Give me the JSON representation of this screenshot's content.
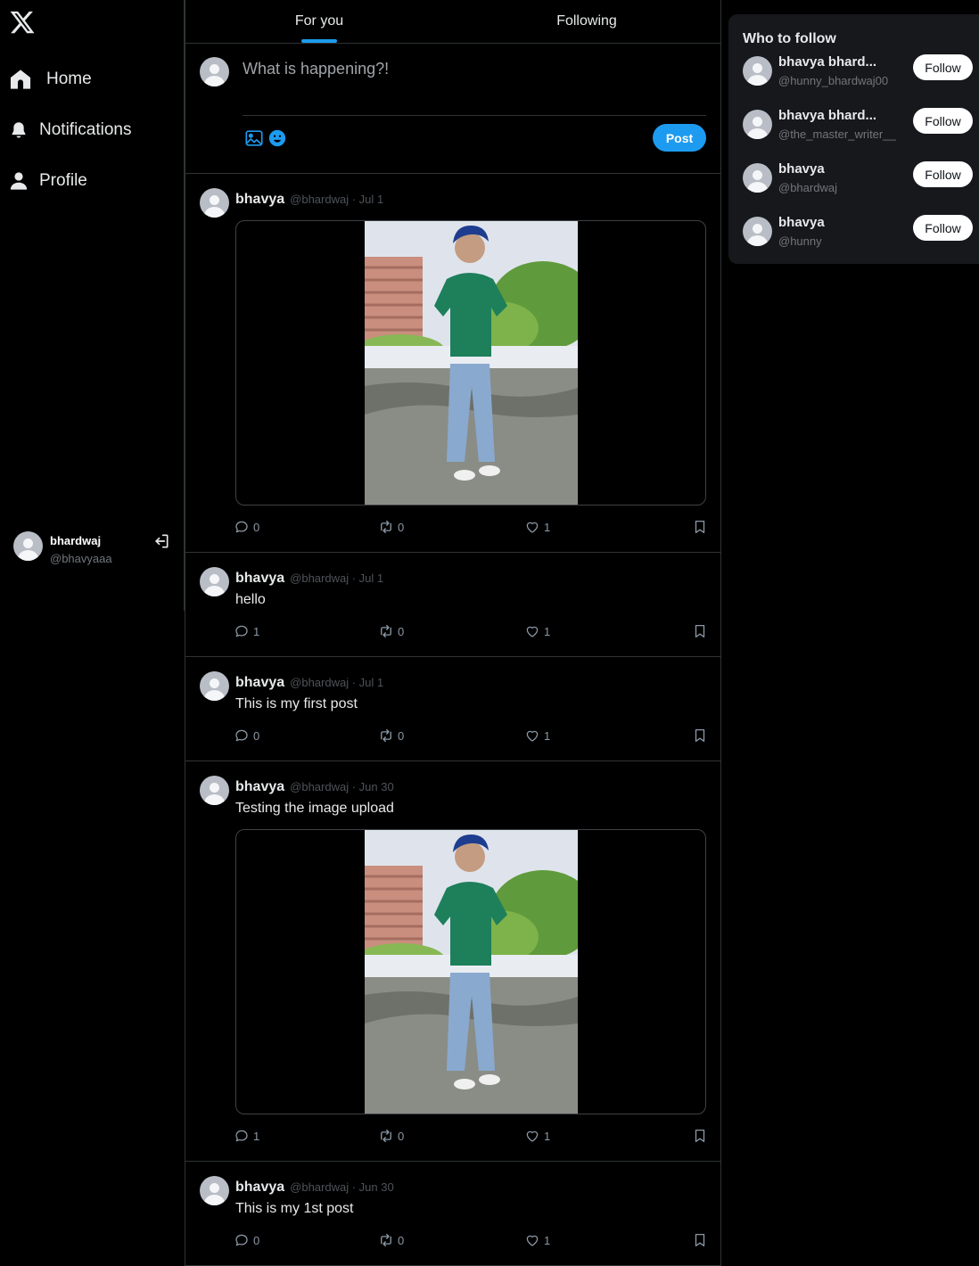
{
  "nav": {
    "logo": "x-logo",
    "items": [
      {
        "label": "Home",
        "icon": "home-icon"
      },
      {
        "label": "Notifications",
        "icon": "bell-icon"
      },
      {
        "label": "Profile",
        "icon": "person-icon"
      }
    ]
  },
  "current_user": {
    "name": "bhardwaj",
    "handle": "@bhavyaaa"
  },
  "tabs": [
    {
      "label": "For you",
      "active": true
    },
    {
      "label": "Following",
      "active": false
    }
  ],
  "composer": {
    "placeholder": "What is happening?!",
    "post_label": "Post"
  },
  "posts": [
    {
      "name": "bhavya",
      "meta": "@bhardwaj · Jul 1",
      "text": "",
      "has_image": true,
      "replies": "0",
      "retweets": "0",
      "likes": "1"
    },
    {
      "name": "bhavya",
      "meta": "@bhardwaj · Jul 1",
      "text": "hello",
      "has_image": false,
      "replies": "1",
      "retweets": "0",
      "likes": "1"
    },
    {
      "name": "bhavya",
      "meta": "@bhardwaj · Jul 1",
      "text": "This is my first post",
      "has_image": false,
      "replies": "0",
      "retweets": "0",
      "likes": "1"
    },
    {
      "name": "bhavya",
      "meta": "@bhardwaj · Jun 30",
      "text": "Testing the image upload",
      "has_image": true,
      "replies": "1",
      "retweets": "0",
      "likes": "1"
    },
    {
      "name": "bhavya",
      "meta": "@bhardwaj · Jun 30",
      "text": "This is my 1st post",
      "has_image": false,
      "replies": "0",
      "retweets": "0",
      "likes": "1"
    }
  ],
  "who_to_follow": {
    "title": "Who to follow",
    "users": [
      {
        "name": "bhavya bhard...",
        "handle": "@hunny_bhardwaj00",
        "button": "Follow"
      },
      {
        "name": "bhavya bhard...",
        "handle": "@the_master_writer__",
        "button": "Follow"
      },
      {
        "name": "bhavya",
        "handle": "@bhardwaj",
        "button": "Follow"
      },
      {
        "name": "bhavya",
        "handle": "@hunny",
        "button": "Follow"
      }
    ]
  },
  "colors": {
    "background": "#000000",
    "accent": "#1d9bf0",
    "border": "#2f3336",
    "panel": "#16181c",
    "muted_text": "#71767b"
  }
}
